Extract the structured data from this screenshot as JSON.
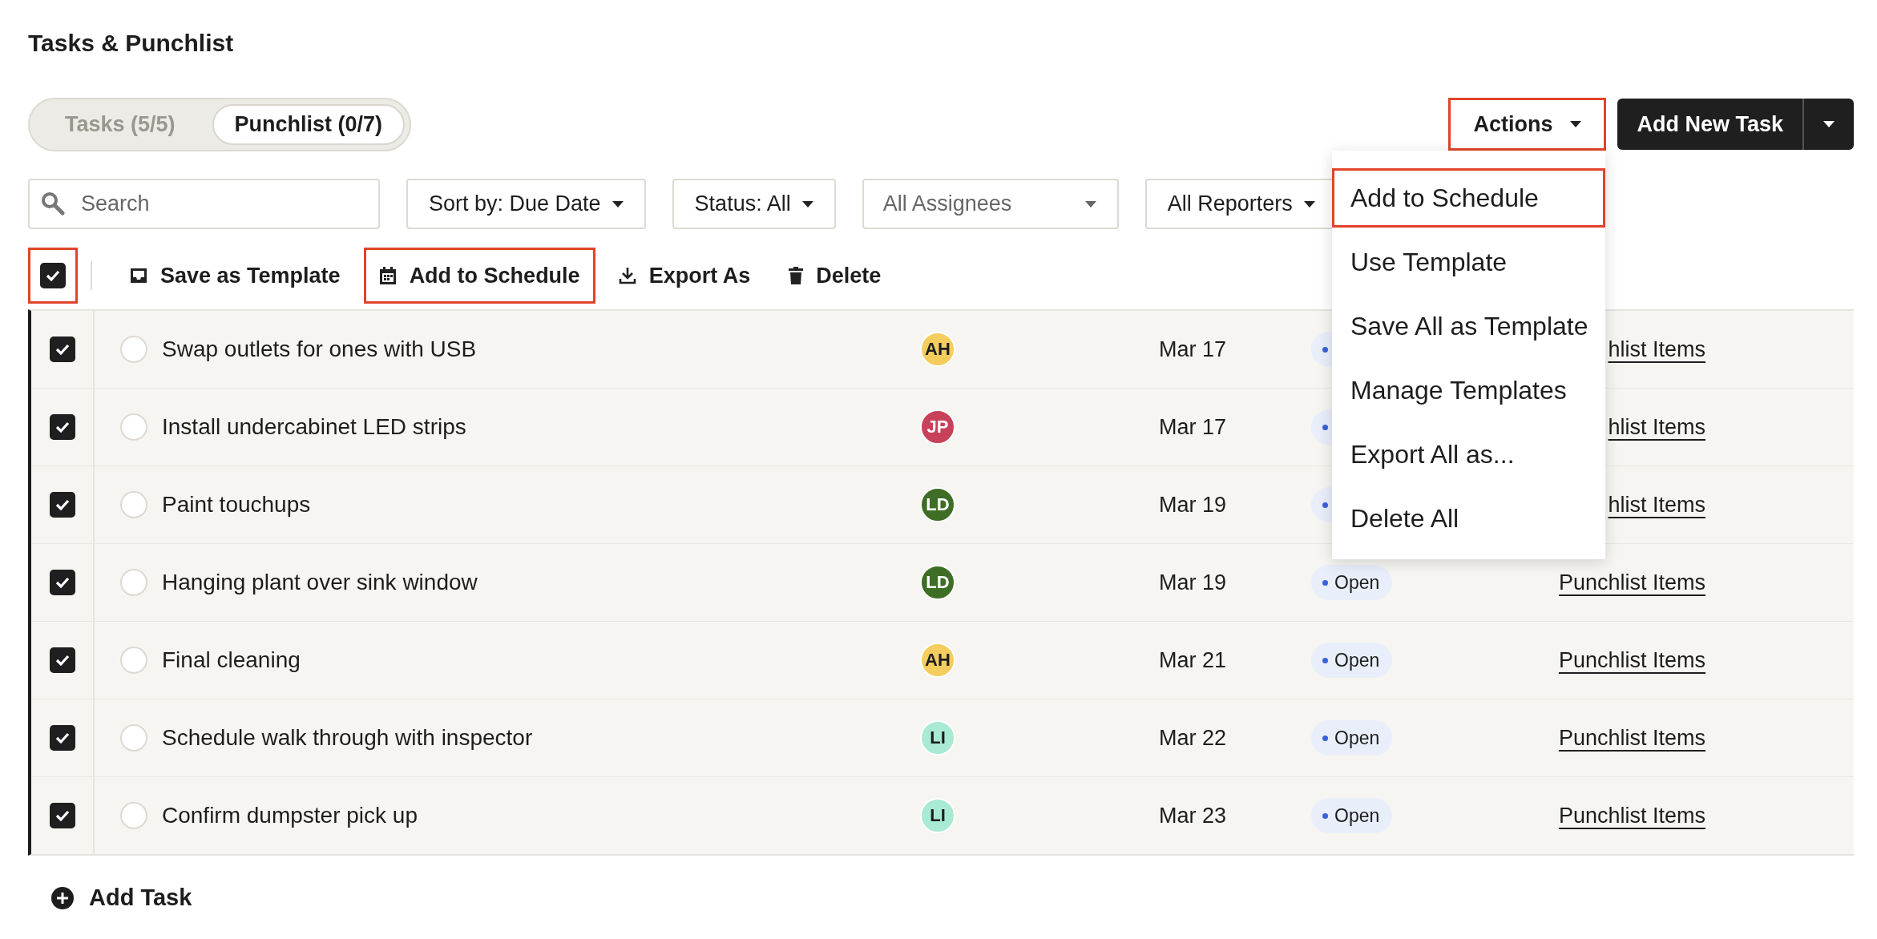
{
  "page_title": "Tasks & Punchlist",
  "tabs": [
    {
      "label": "Tasks (5/5)",
      "selected": false
    },
    {
      "label": "Punchlist (0/7)",
      "selected": true
    }
  ],
  "actions_button": {
    "label": "Actions",
    "highlighted": true
  },
  "add_new_task_button": {
    "label": "Add New Task"
  },
  "filters": {
    "search": {
      "placeholder": "Search"
    },
    "dropdowns": [
      {
        "label": "Sort by: Due Date",
        "placeholder": false
      },
      {
        "label": "Status: All",
        "placeholder": false
      },
      {
        "label": "All Assignees",
        "placeholder": true
      },
      {
        "label": "All Reporters",
        "placeholder": false
      }
    ]
  },
  "bulk_bar": {
    "select_all": {
      "checked": true,
      "highlighted": true
    },
    "actions": [
      {
        "kind": "template",
        "label": "Save as Template",
        "highlighted": false
      },
      {
        "kind": "schedule",
        "label": "Add to Schedule",
        "highlighted": true
      },
      {
        "kind": "export",
        "label": "Export As",
        "highlighted": false
      },
      {
        "kind": "delete",
        "label": "Delete",
        "highlighted": false
      }
    ]
  },
  "rows": [
    {
      "checked": true,
      "completed": false,
      "task": "Swap outlets for ones with USB",
      "assignee": {
        "initials": "AH",
        "color": "#f5cd5f"
      },
      "due": "Mar 17",
      "link": "hlist Items"
    },
    {
      "checked": true,
      "completed": false,
      "task": "Install undercabinet LED strips",
      "assignee": {
        "initials": "JP",
        "color": "#c8415a"
      },
      "due": "Mar 17",
      "link": "hlist Items"
    },
    {
      "checked": true,
      "completed": false,
      "task": "Paint touchups",
      "assignee": {
        "initials": "LD",
        "color": "#3e6e25"
      },
      "due": "Mar 19",
      "link": "hlist Items"
    },
    {
      "checked": true,
      "completed": false,
      "task": "Hanging plant over sink window",
      "assignee": {
        "initials": "LD",
        "color": "#3e6e25"
      },
      "due": "Mar 19",
      "status": {
        "text": "Open"
      },
      "link": "Punchlist Items"
    },
    {
      "checked": true,
      "completed": false,
      "task": "Final cleaning",
      "assignee": {
        "initials": "AH",
        "color": "#f5cd5f"
      },
      "due": "Mar 21",
      "status": {
        "text": "Open"
      },
      "link": "Punchlist Items"
    },
    {
      "checked": true,
      "completed": false,
      "task": "Schedule walk through with inspector",
      "assignee": {
        "initials": "LI",
        "color": "#a8ead3"
      },
      "due": "Mar 22",
      "status": {
        "text": "Open"
      },
      "link": "Punchlist Items"
    },
    {
      "checked": true,
      "completed": false,
      "task": "Confirm dumpster pick up",
      "assignee": {
        "initials": "LI",
        "color": "#a8ead3"
      },
      "due": "Mar 23",
      "status": {
        "text": "Open"
      },
      "link": "Punchlist Items"
    }
  ],
  "add_task": {
    "label": "Add Task"
  },
  "actions_menu": {
    "items": [
      {
        "label": "Add to Schedule",
        "highlighted": true
      },
      {
        "label": "Use Template",
        "highlighted": false
      },
      {
        "label": "Save All as Template",
        "highlighted": false
      },
      {
        "label": "Manage Templates",
        "highlighted": false
      },
      {
        "label": "Export All as...",
        "highlighted": false
      },
      {
        "label": "Delete All",
        "highlighted": false
      }
    ]
  }
}
